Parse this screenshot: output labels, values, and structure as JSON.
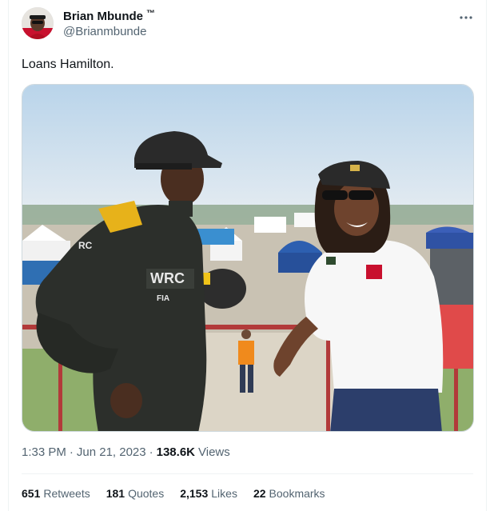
{
  "author": {
    "name": "Brian Mbunde",
    "tm_mark": "™",
    "handle": "@Brianmbunde"
  },
  "tweet": {
    "text": "Loans Hamilton.",
    "media_caption_marks": [
      "WRC",
      "FIA",
      "RC"
    ]
  },
  "meta": {
    "time": "1:33 PM",
    "separator": "·",
    "date": "Jun 21, 2023",
    "views_count": "138.6K",
    "views_label": "Views"
  },
  "stats": [
    {
      "count": "651",
      "label": "Retweets"
    },
    {
      "count": "181",
      "label": "Quotes"
    },
    {
      "count": "2,153",
      "label": "Likes"
    },
    {
      "count": "22",
      "label": "Bookmarks"
    }
  ],
  "colors": {
    "text": "#0f1419",
    "secondary": "#536471",
    "border": "#cfd9de",
    "divider": "#eff3f4"
  },
  "icons": {
    "more": "more-horizontal-icon"
  }
}
